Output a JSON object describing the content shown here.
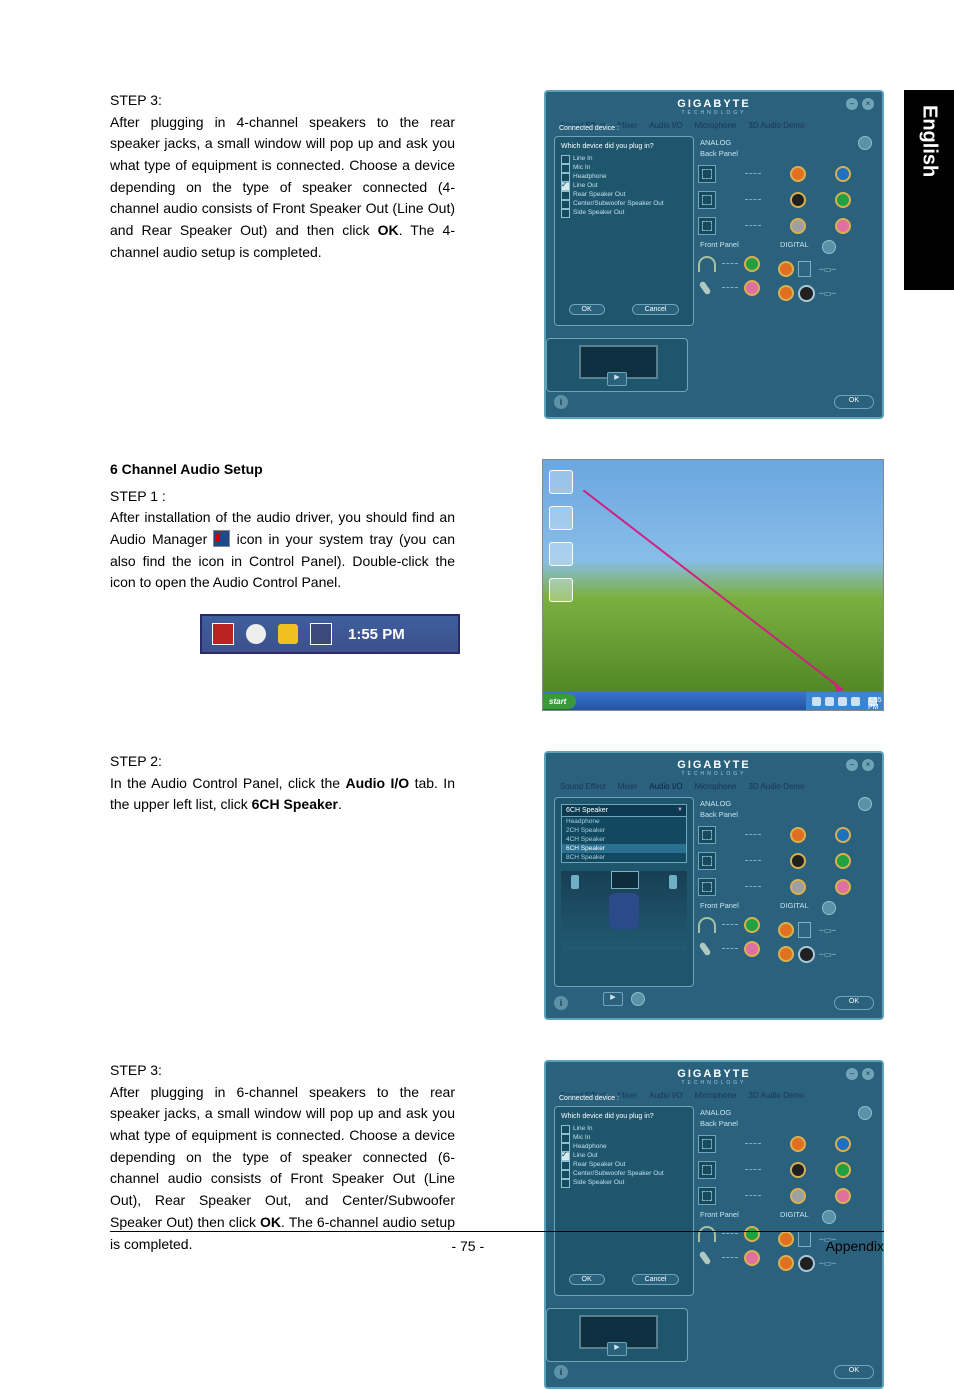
{
  "side_tab": "English",
  "footer": {
    "page": "- 75 -",
    "section": "Appendix"
  },
  "tray": {
    "time": "1:55 PM"
  },
  "gigabyte": {
    "logo": "GIGABYTE",
    "sub": "TECHNOLOGY",
    "tabs": [
      "Sound Effect",
      "Mixer",
      "Audio I/O",
      "Microphone",
      "3D Audio Demo"
    ],
    "connected_title": "Connected device :",
    "connected_q": "Which device did you plug in?",
    "devices": [
      "Line In",
      "Mic In",
      "Headphone",
      "Line Out",
      "Rear Speaker Out",
      "Center/Subwoofer Speaker Out",
      "Side Speaker Out"
    ],
    "ok": "OK",
    "cancel": "Cancel",
    "analog": "ANALOG",
    "back_panel": "Back Panel",
    "front_panel": "Front Panel",
    "digital": "DIGITAL",
    "footer_ok": "OK",
    "dropdown_label": "6CH Speaker",
    "dropdown_opts": [
      "Headphone",
      "2CH Speaker",
      "4CH Speaker",
      "6CH Speaker",
      "8CH Speaker"
    ]
  },
  "desktop": {
    "start": "start",
    "time": "1:55 PM"
  },
  "s1": {
    "step": "STEP 3:",
    "body_a": "After plugging in 4-channel speakers to the rear speaker jacks, a small window will pop up and ask you what type of equipment is connected. Choose a device depending on the type of speaker connected (4-channel audio consists of Front Speaker Out (Line Out) and Rear Speaker Out) and then click ",
    "body_b": "OK",
    "body_c": ". The 4-channel audio setup is completed."
  },
  "s2": {
    "heading": "6 Channel Audio Setup",
    "step": "STEP 1 :",
    "body_a": "After installation of the audio driver, you should find an Audio Manager ",
    "body_b": " icon in your system tray (you can also find the icon in Control Panel).  Double-click the icon to open the Audio Control Panel."
  },
  "s3": {
    "step": "STEP 2:",
    "body_a": "In the Audio Control Panel, click the ",
    "body_b": "Audio I/O",
    "body_c": " tab. In the upper left list, click ",
    "body_d": "6CH Speaker",
    "body_e": "."
  },
  "s4": {
    "step": "STEP 3:",
    "body_a": "After plugging in 6-channel speakers to the rear speaker jacks, a small window will pop up and ask you what type of equipment is connected. Choose a device depending on the type of speaker connected (6-channel audio consists of Front Speaker Out (Line Out), Rear Speaker Out, and Center/Subwoofer Speaker Out) then click ",
    "body_b": "OK",
    "body_c": ". The 6-channel audio setup is completed."
  }
}
